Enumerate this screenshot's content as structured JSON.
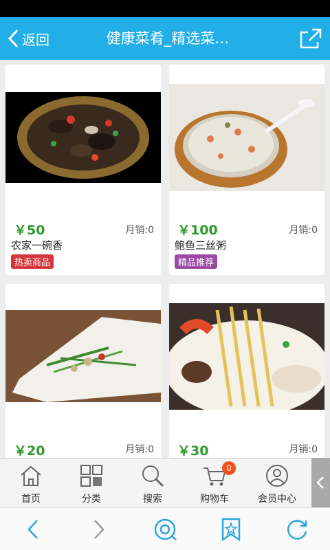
{
  "header": {
    "back_label": "返回",
    "title": "健康菜肴_精选菜…"
  },
  "products": [
    {
      "price": "￥50",
      "sales": "月销:0",
      "name": "农家一碗香",
      "badge": "热卖商品",
      "badge_color": "#d5373d"
    },
    {
      "price": "￥100",
      "sales": "月销:0",
      "name": "鲍鱼三丝粥",
      "badge": "精品推荐",
      "badge_color": "#9a4aa3"
    },
    {
      "price": "￥20",
      "sales": "月销:0"
    },
    {
      "price": "￥30",
      "sales": "月销:0"
    }
  ],
  "tabs": [
    {
      "label": "首页",
      "icon": "home-icon"
    },
    {
      "label": "分类",
      "icon": "category-grid-icon"
    },
    {
      "label": "搜索",
      "icon": "search-icon"
    },
    {
      "label": "购物车",
      "icon": "cart-icon",
      "badge": "0"
    },
    {
      "label": "会员中心",
      "icon": "user-icon"
    }
  ],
  "colors": {
    "header": "#22aee6",
    "price": "#2e9b2a",
    "accent_badge": "#f4511e"
  }
}
